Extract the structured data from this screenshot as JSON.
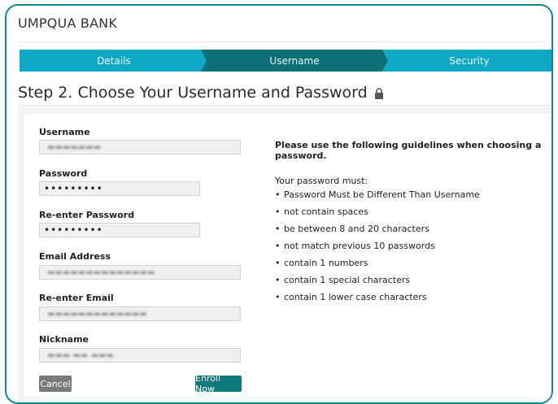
{
  "brand": {
    "name": "UMPQUA BANK"
  },
  "steps": [
    {
      "label": "Details"
    },
    {
      "label": "Username"
    },
    {
      "label": "Security"
    }
  ],
  "page": {
    "title": "Step 2. Choose Your Username and Password"
  },
  "form": {
    "fields": [
      {
        "label": "Username",
        "value": ""
      },
      {
        "label": "Password",
        "value": "•••••••••"
      },
      {
        "label": "Re-enter Password",
        "value": "•••••••••"
      },
      {
        "label": "Email Address",
        "value": ""
      },
      {
        "label": "Re-enter Email",
        "value": ""
      },
      {
        "label": "Nickname",
        "value": ""
      }
    ],
    "cancel_label": "Cancel",
    "enroll_label": "Enroll Now"
  },
  "guidelines": {
    "heading": "Please use the following guidelines when choosing a password.",
    "intro": "Your password must:",
    "rules": [
      "Password Must be Different Than Username",
      "not contain spaces",
      "be between 8 and 20 characters",
      "not match previous 10 passwords",
      "contain 1 numbers",
      "contain 1 special characters",
      "contain 1 lower case characters"
    ]
  },
  "icons": {
    "lock": "lock-icon"
  },
  "colors": {
    "accent": "#10a9c5",
    "active_step": "#0f6f77",
    "enroll_button": "#0f7b7d",
    "frame": "#0f8a94"
  }
}
